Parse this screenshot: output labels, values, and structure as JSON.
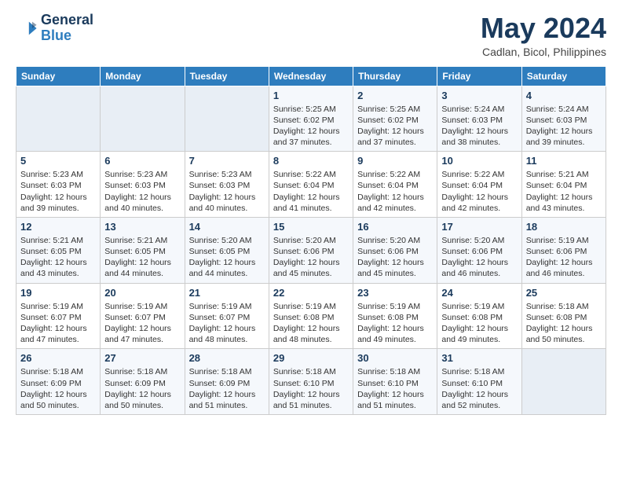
{
  "logo": {
    "line1": "General",
    "line2": "Blue"
  },
  "title": "May 2024",
  "subtitle": "Cadlan, Bicol, Philippines",
  "days_header": [
    "Sunday",
    "Monday",
    "Tuesday",
    "Wednesday",
    "Thursday",
    "Friday",
    "Saturday"
  ],
  "weeks": [
    [
      {
        "day": "",
        "info": ""
      },
      {
        "day": "",
        "info": ""
      },
      {
        "day": "",
        "info": ""
      },
      {
        "day": "1",
        "info": "Sunrise: 5:25 AM\nSunset: 6:02 PM\nDaylight: 12 hours\nand 37 minutes."
      },
      {
        "day": "2",
        "info": "Sunrise: 5:25 AM\nSunset: 6:02 PM\nDaylight: 12 hours\nand 37 minutes."
      },
      {
        "day": "3",
        "info": "Sunrise: 5:24 AM\nSunset: 6:03 PM\nDaylight: 12 hours\nand 38 minutes."
      },
      {
        "day": "4",
        "info": "Sunrise: 5:24 AM\nSunset: 6:03 PM\nDaylight: 12 hours\nand 39 minutes."
      }
    ],
    [
      {
        "day": "5",
        "info": "Sunrise: 5:23 AM\nSunset: 6:03 PM\nDaylight: 12 hours\nand 39 minutes."
      },
      {
        "day": "6",
        "info": "Sunrise: 5:23 AM\nSunset: 6:03 PM\nDaylight: 12 hours\nand 40 minutes."
      },
      {
        "day": "7",
        "info": "Sunrise: 5:23 AM\nSunset: 6:03 PM\nDaylight: 12 hours\nand 40 minutes."
      },
      {
        "day": "8",
        "info": "Sunrise: 5:22 AM\nSunset: 6:04 PM\nDaylight: 12 hours\nand 41 minutes."
      },
      {
        "day": "9",
        "info": "Sunrise: 5:22 AM\nSunset: 6:04 PM\nDaylight: 12 hours\nand 42 minutes."
      },
      {
        "day": "10",
        "info": "Sunrise: 5:22 AM\nSunset: 6:04 PM\nDaylight: 12 hours\nand 42 minutes."
      },
      {
        "day": "11",
        "info": "Sunrise: 5:21 AM\nSunset: 6:04 PM\nDaylight: 12 hours\nand 43 minutes."
      }
    ],
    [
      {
        "day": "12",
        "info": "Sunrise: 5:21 AM\nSunset: 6:05 PM\nDaylight: 12 hours\nand 43 minutes."
      },
      {
        "day": "13",
        "info": "Sunrise: 5:21 AM\nSunset: 6:05 PM\nDaylight: 12 hours\nand 44 minutes."
      },
      {
        "day": "14",
        "info": "Sunrise: 5:20 AM\nSunset: 6:05 PM\nDaylight: 12 hours\nand 44 minutes."
      },
      {
        "day": "15",
        "info": "Sunrise: 5:20 AM\nSunset: 6:06 PM\nDaylight: 12 hours\nand 45 minutes."
      },
      {
        "day": "16",
        "info": "Sunrise: 5:20 AM\nSunset: 6:06 PM\nDaylight: 12 hours\nand 45 minutes."
      },
      {
        "day": "17",
        "info": "Sunrise: 5:20 AM\nSunset: 6:06 PM\nDaylight: 12 hours\nand 46 minutes."
      },
      {
        "day": "18",
        "info": "Sunrise: 5:19 AM\nSunset: 6:06 PM\nDaylight: 12 hours\nand 46 minutes."
      }
    ],
    [
      {
        "day": "19",
        "info": "Sunrise: 5:19 AM\nSunset: 6:07 PM\nDaylight: 12 hours\nand 47 minutes."
      },
      {
        "day": "20",
        "info": "Sunrise: 5:19 AM\nSunset: 6:07 PM\nDaylight: 12 hours\nand 47 minutes."
      },
      {
        "day": "21",
        "info": "Sunrise: 5:19 AM\nSunset: 6:07 PM\nDaylight: 12 hours\nand 48 minutes."
      },
      {
        "day": "22",
        "info": "Sunrise: 5:19 AM\nSunset: 6:08 PM\nDaylight: 12 hours\nand 48 minutes."
      },
      {
        "day": "23",
        "info": "Sunrise: 5:19 AM\nSunset: 6:08 PM\nDaylight: 12 hours\nand 49 minutes."
      },
      {
        "day": "24",
        "info": "Sunrise: 5:19 AM\nSunset: 6:08 PM\nDaylight: 12 hours\nand 49 minutes."
      },
      {
        "day": "25",
        "info": "Sunrise: 5:18 AM\nSunset: 6:08 PM\nDaylight: 12 hours\nand 50 minutes."
      }
    ],
    [
      {
        "day": "26",
        "info": "Sunrise: 5:18 AM\nSunset: 6:09 PM\nDaylight: 12 hours\nand 50 minutes."
      },
      {
        "day": "27",
        "info": "Sunrise: 5:18 AM\nSunset: 6:09 PM\nDaylight: 12 hours\nand 50 minutes."
      },
      {
        "day": "28",
        "info": "Sunrise: 5:18 AM\nSunset: 6:09 PM\nDaylight: 12 hours\nand 51 minutes."
      },
      {
        "day": "29",
        "info": "Sunrise: 5:18 AM\nSunset: 6:10 PM\nDaylight: 12 hours\nand 51 minutes."
      },
      {
        "day": "30",
        "info": "Sunrise: 5:18 AM\nSunset: 6:10 PM\nDaylight: 12 hours\nand 51 minutes."
      },
      {
        "day": "31",
        "info": "Sunrise: 5:18 AM\nSunset: 6:10 PM\nDaylight: 12 hours\nand 52 minutes."
      },
      {
        "day": "",
        "info": ""
      }
    ]
  ]
}
